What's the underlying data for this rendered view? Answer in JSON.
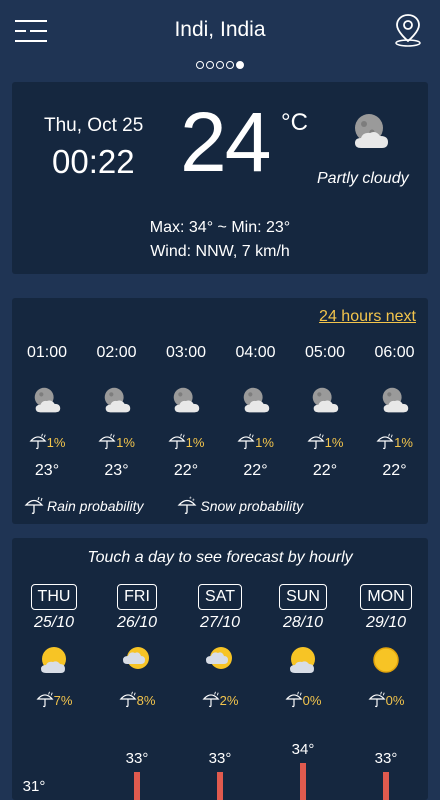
{
  "header": {
    "location": "Indi, India",
    "menu_icon": "menu-icon",
    "location_icon": "map-pin-icon",
    "page_count": 5,
    "active_page": 5
  },
  "current": {
    "date": "Thu, Oct 25",
    "time": "00:22",
    "temperature": "24",
    "unit": "°C",
    "condition": "Partly cloudy",
    "condition_icon": "night-partly-cloudy-icon",
    "max_min": "Max: 34° ~ Min: 23°",
    "wind": "Wind: NNW, 7 km/h"
  },
  "hourly": {
    "link_label": "24 hours next",
    "hours": [
      {
        "time": "01:00",
        "icon": "night-partly-cloudy-icon",
        "prob": "1%",
        "temp": "23°"
      },
      {
        "time": "02:00",
        "icon": "night-partly-cloudy-icon",
        "prob": "1%",
        "temp": "23°"
      },
      {
        "time": "03:00",
        "icon": "night-partly-cloudy-icon",
        "prob": "1%",
        "temp": "22°"
      },
      {
        "time": "04:00",
        "icon": "night-partly-cloudy-icon",
        "prob": "1%",
        "temp": "22°"
      },
      {
        "time": "05:00",
        "icon": "night-partly-cloudy-icon",
        "prob": "1%",
        "temp": "22°"
      },
      {
        "time": "06:00",
        "icon": "night-partly-cloudy-icon",
        "prob": "1%",
        "temp": "22°"
      }
    ],
    "legend": {
      "rain_label": "Rain probability",
      "snow_label": "Snow probability"
    }
  },
  "daily": {
    "hint": "Touch a day to see forecast by hourly",
    "days": [
      {
        "name": "THU",
        "date": "25/10",
        "icon": "sun-cloud-icon",
        "prob": "7%",
        "high": "31°",
        "high_value": 31
      },
      {
        "name": "FRI",
        "date": "26/10",
        "icon": "cloud-sun-icon",
        "prob": "8%",
        "high": "33°",
        "high_value": 33
      },
      {
        "name": "SAT",
        "date": "27/10",
        "icon": "cloud-sun-icon",
        "prob": "2%",
        "high": "33°",
        "high_value": 33
      },
      {
        "name": "SUN",
        "date": "28/10",
        "icon": "sun-cloud-icon",
        "prob": "0%",
        "high": "34°",
        "high_value": 34
      },
      {
        "name": "MON",
        "date": "29/10",
        "icon": "sun-icon",
        "prob": "0%",
        "high": "33°",
        "high_value": 33
      }
    ]
  },
  "colors": {
    "background": "#1f3454",
    "card": "#15273f",
    "accent": "#f2c44c",
    "temp_bar": "#e05a4e"
  }
}
